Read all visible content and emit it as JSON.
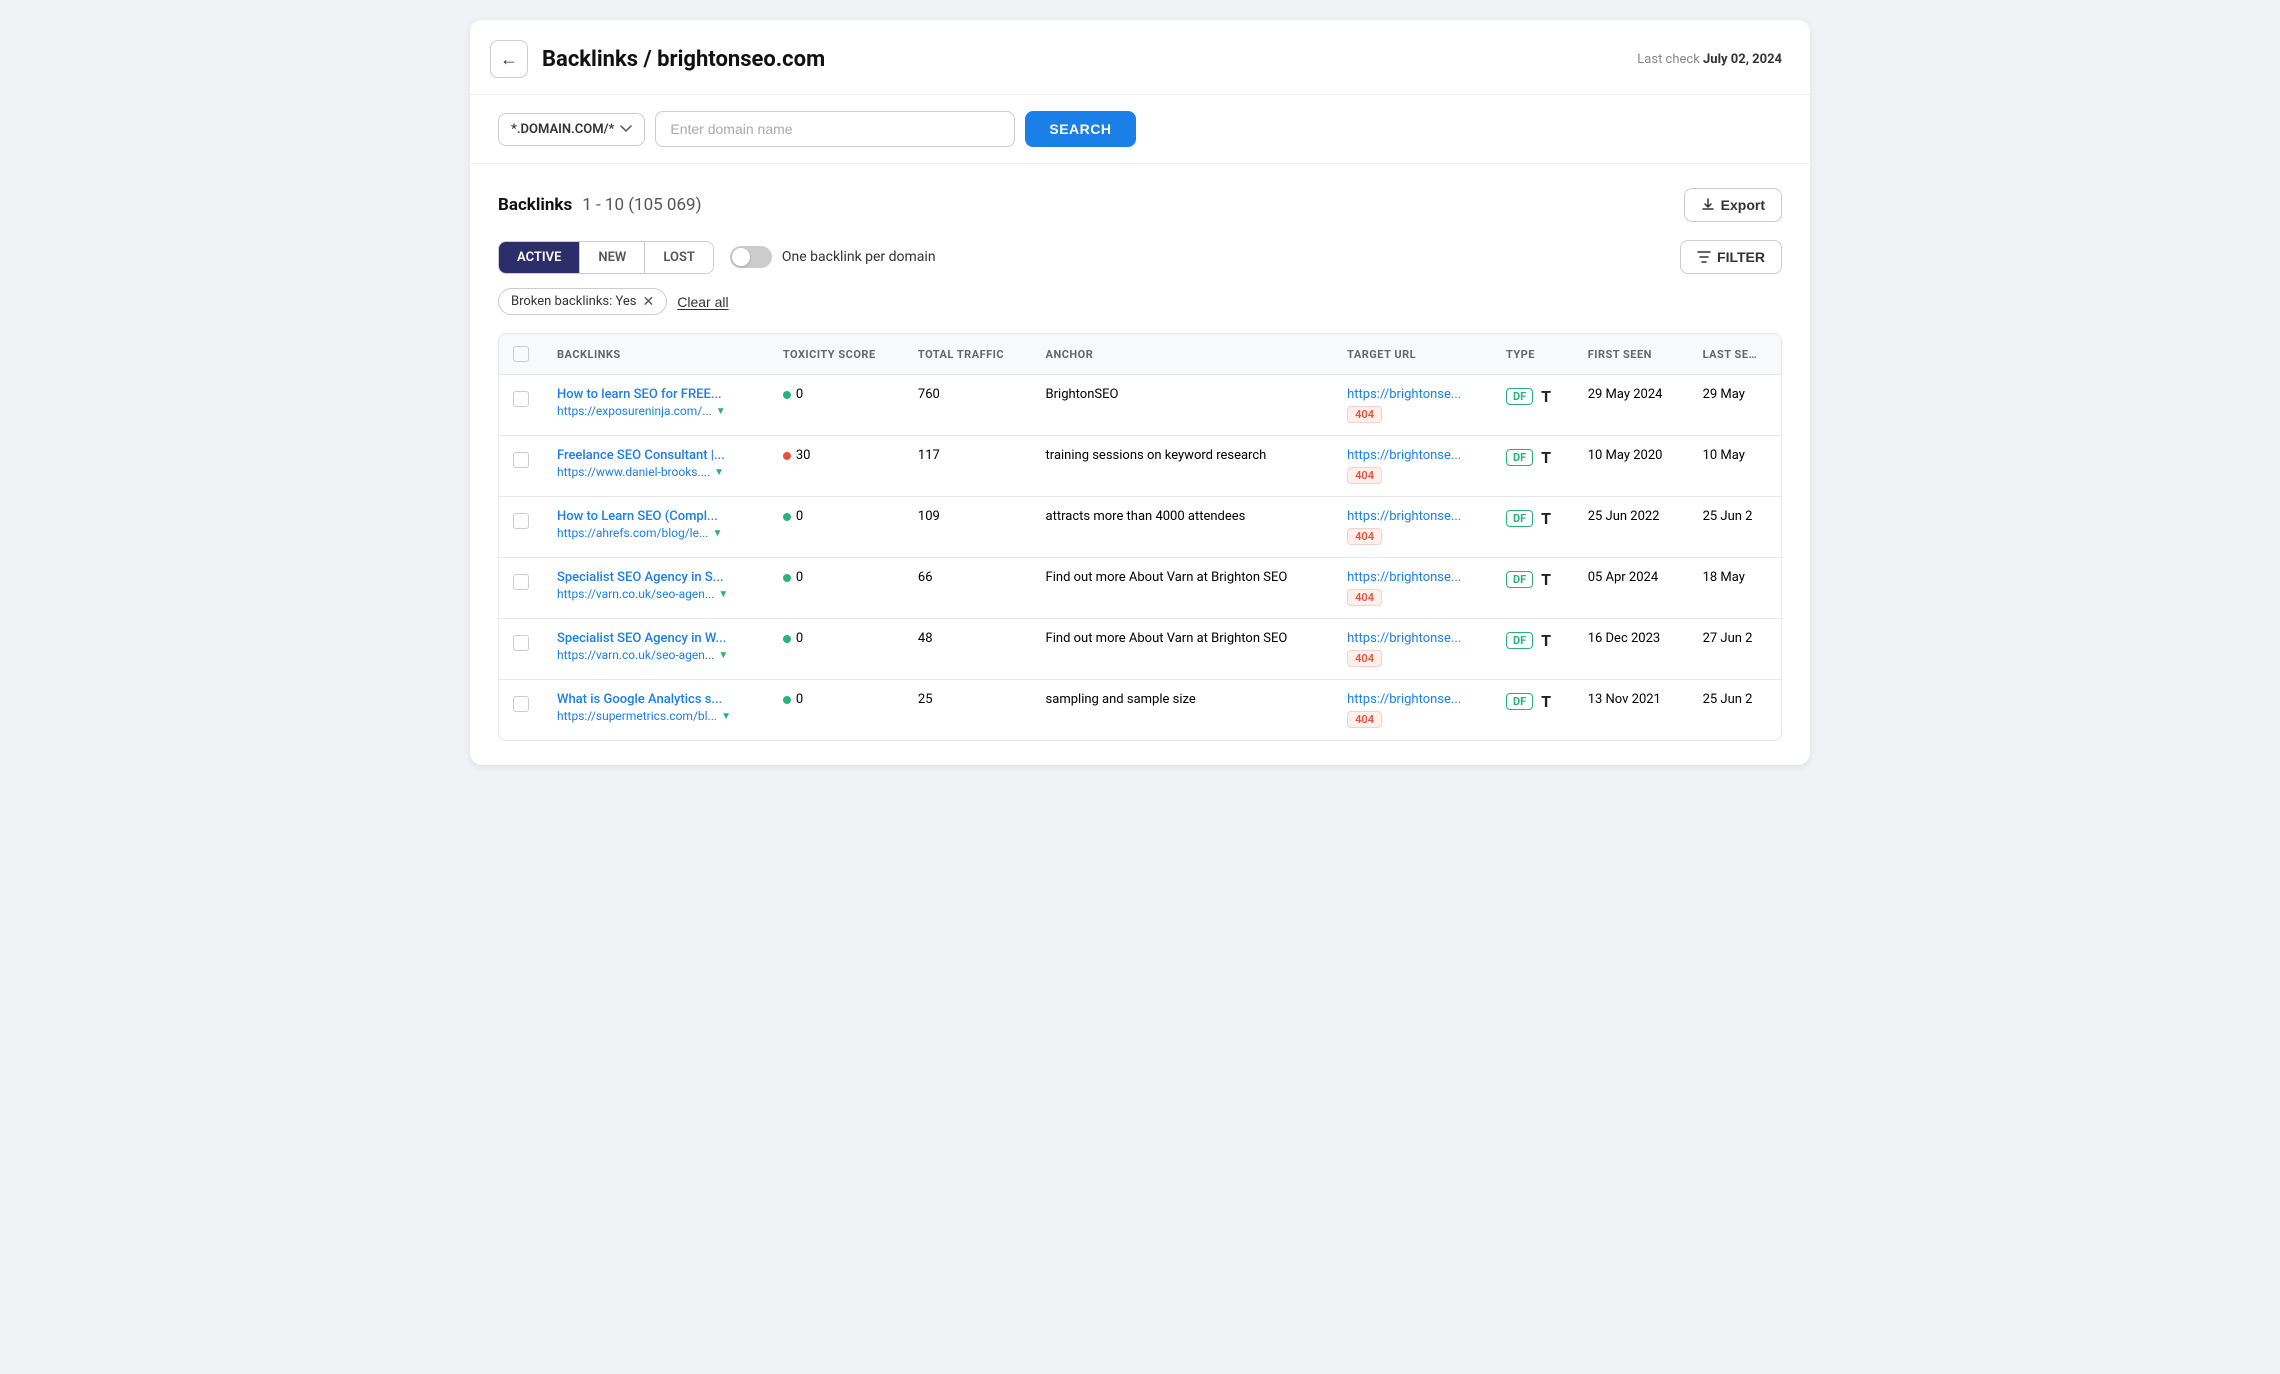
{
  "header": {
    "back_label": "←",
    "title": "Backlinks / brightonseo.com",
    "last_check_label": "Last check",
    "last_check_date": "July 02, 2024"
  },
  "search": {
    "domain_select": "*.DOMAIN.COM/*",
    "placeholder": "Enter domain name",
    "button_label": "SEARCH"
  },
  "backlinks_section": {
    "title": "Backlinks",
    "count": "1 - 10 (105 069)",
    "export_label": "Export"
  },
  "tabs": [
    {
      "label": "ACTIVE",
      "active": true
    },
    {
      "label": "NEW",
      "active": false
    },
    {
      "label": "LOST",
      "active": false
    }
  ],
  "toggle": {
    "label": "One backlink per domain",
    "enabled": false
  },
  "filter_button": "FILTER",
  "active_filters": [
    {
      "label": "Broken backlinks: Yes"
    }
  ],
  "clear_all_label": "Clear all",
  "table": {
    "columns": [
      "BACKLINKS",
      "TOXICITY SCORE",
      "TOTAL TRAFFIC",
      "ANCHOR",
      "TARGET URL",
      "TYPE",
      "FIRST SEEN",
      "LAST SE…"
    ],
    "rows": [
      {
        "backlink_title": "How to learn SEO for FREE...",
        "backlink_url": "https://exposureninja.com/...",
        "toxicity": 0,
        "toxicity_color": "green",
        "traffic": 760,
        "anchor": "BrightonSEO",
        "target_url": "https://brightonse...",
        "target_badge": "404",
        "type_df": "DF",
        "type_t": "T",
        "first_seen": "29 May 2024",
        "last_seen": "29 May"
      },
      {
        "backlink_title": "Freelance SEO Consultant |...",
        "backlink_url": "https://www.daniel-brooks....",
        "toxicity": 30,
        "toxicity_color": "red",
        "traffic": 117,
        "anchor": "training sessions on keyword research",
        "target_url": "https://brightonse...",
        "target_badge": "404",
        "type_df": "DF",
        "type_t": "T",
        "first_seen": "10 May 2020",
        "last_seen": "10 May"
      },
      {
        "backlink_title": "How to Learn SEO (Compl...",
        "backlink_url": "https://ahrefs.com/blog/le...",
        "toxicity": 0,
        "toxicity_color": "green",
        "traffic": 109,
        "anchor": "attracts more than 4000 attendees",
        "target_url": "https://brightonse...",
        "target_badge": "404",
        "type_df": "DF",
        "type_t": "T",
        "first_seen": "25 Jun 2022",
        "last_seen": "25 Jun 2"
      },
      {
        "backlink_title": "Specialist SEO Agency in S...",
        "backlink_url": "https://varn.co.uk/seo-agen...",
        "toxicity": 0,
        "toxicity_color": "green",
        "traffic": 66,
        "anchor": "Find out more About Varn at Brighton SEO",
        "target_url": "https://brightonse...",
        "target_badge": "404",
        "type_df": "DF",
        "type_t": "T",
        "first_seen": "05 Apr 2024",
        "last_seen": "18 May"
      },
      {
        "backlink_title": "Specialist SEO Agency in W...",
        "backlink_url": "https://varn.co.uk/seo-agen...",
        "toxicity": 0,
        "toxicity_color": "green",
        "traffic": 48,
        "anchor": "Find out more About Varn at Brighton SEO",
        "target_url": "https://brightonse...",
        "target_badge": "404",
        "type_df": "DF",
        "type_t": "T",
        "first_seen": "16 Dec 2023",
        "last_seen": "27 Jun 2"
      },
      {
        "backlink_title": "What is Google Analytics s...",
        "backlink_url": "https://supermetrics.com/bl...",
        "toxicity": 0,
        "toxicity_color": "green",
        "traffic": 25,
        "anchor": "sampling and sample size",
        "target_url": "https://brightonse...",
        "target_badge": "404",
        "type_df": "DF",
        "type_t": "T",
        "first_seen": "13 Nov 2021",
        "last_seen": "25 Jun 2"
      }
    ]
  }
}
